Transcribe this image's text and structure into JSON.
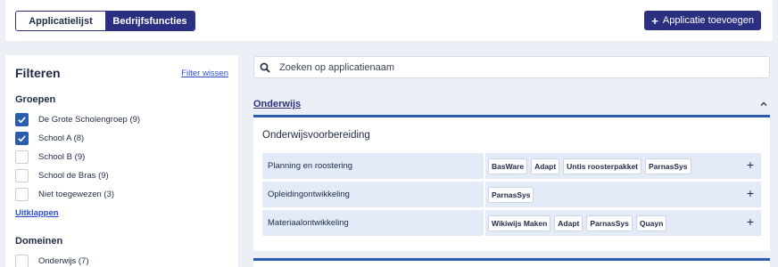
{
  "tabs": [
    {
      "label": "Applicatielijst",
      "active": false
    },
    {
      "label": "Bedrijfsfuncties",
      "active": true
    }
  ],
  "add_button": {
    "label": "Applicatie toevoegen",
    "icon": "plus-icon"
  },
  "filters": {
    "title": "Filteren",
    "clear_label": "Filter wissen",
    "groups": {
      "title": "Groepen",
      "items": [
        {
          "label": "De Grote Scholengroep (9)",
          "checked": true
        },
        {
          "label": "School A (8)",
          "checked": true
        },
        {
          "label": "School B (9)",
          "checked": false
        },
        {
          "label": "School de Bras (9)",
          "checked": false
        },
        {
          "label": "Niet toegewezen (3)",
          "checked": false
        }
      ],
      "expand_label": "Uitklappen"
    },
    "domains": {
      "title": "Domeinen",
      "items": [
        {
          "label": "Onderwijs (7)",
          "checked": false
        }
      ]
    }
  },
  "search": {
    "placeholder": "Zoeken op applicatienaam",
    "value": "",
    "icon": "search-icon"
  },
  "category": {
    "title": "Onderwijs",
    "expanded": true,
    "subcategory": "Onderwijsvoorbereiding",
    "functions": [
      {
        "label": "Planning en roostering",
        "apps": [
          "BasWare",
          "Adapt",
          "Untis roosterpakket",
          "ParnasSys"
        ]
      },
      {
        "label": "Opleidingontwikkeling",
        "apps": [
          "ParnasSys"
        ]
      },
      {
        "label": "Materiaalontwikkeling",
        "apps": [
          "Wikiwijs Maken",
          "Adapt",
          "ParnasSys",
          "Quayn"
        ]
      }
    ]
  },
  "colors": {
    "primary": "#2b2f7f",
    "accent": "#2a5db0",
    "row_bg": "#e2ebf7",
    "page_bg": "#eceff5"
  }
}
